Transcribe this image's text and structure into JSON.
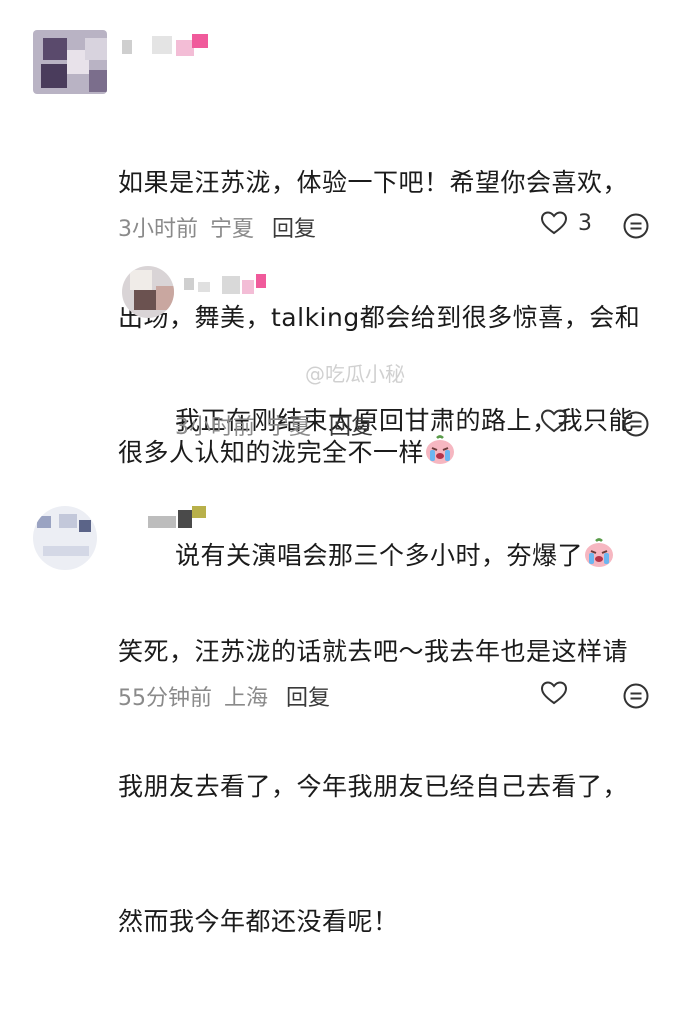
{
  "comments": [
    {
      "text_lines": [
        "如果是汪苏泷，体验一下吧！希望你会喜欢，",
        "出场，舞美，talking都会给到很多惊喜，会和",
        "很多人认知的泷完全不一样"
      ],
      "time": "3小时前",
      "location": "宁夏",
      "reply_label": "回复",
      "likes": "3"
    },
    {
      "text_lines": [
        "我正在刚结束太原回甘肃的路上，我只能",
        "说有关演唱会那三个多小时，夯爆了"
      ],
      "time": "3小时前",
      "location": "宁夏",
      "reply_label": "回复",
      "likes": ""
    },
    {
      "text_lines": [
        "笑死，汪苏泷的话就去吧～我去年也是这样请",
        "我朋友去看了，今年我朋友已经自己去看了，",
        "然而我今年都还没看呢！"
      ],
      "time": "55分钟前",
      "location": "上海",
      "reply_label": "回复",
      "likes": ""
    }
  ],
  "watermark": "@吃瓜小秘",
  "colors": {
    "accent_pink": "#f05a9b",
    "meta_gray": "#8a8a8a"
  },
  "icons": [
    "heart-outline-icon",
    "comment-bubble-icon",
    "crying-face-emoji"
  ]
}
